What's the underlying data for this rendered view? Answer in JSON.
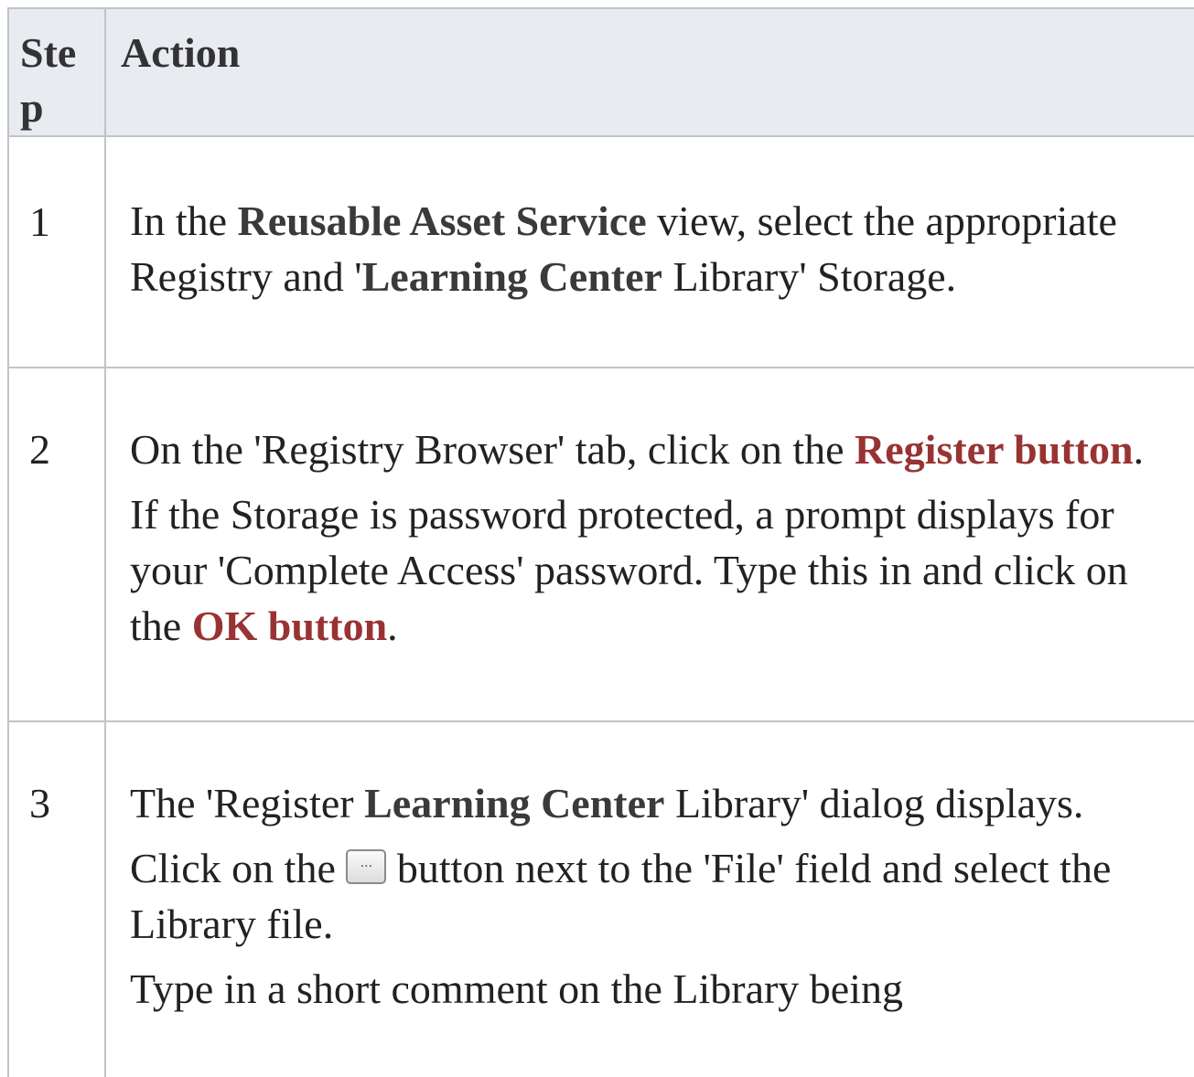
{
  "header": {
    "step": "Ste p",
    "action": "Action"
  },
  "rows": [
    {
      "step": "1",
      "p1": {
        "a": "In the ",
        "b": "Reusable Asset Service",
        "c": " view, select the appropriate Registry and '",
        "d": "Learning Center",
        "e": " Library' Storage."
      }
    },
    {
      "step": "2",
      "p1": {
        "a": "On the 'Registry Browser' tab, click on the ",
        "b": "Register button",
        "c": "."
      },
      "p2": {
        "a": "If the Storage is password protected, a prompt displays for your 'Complete Access' password. Type this in and click on the ",
        "b": "OK button",
        "c": "."
      }
    },
    {
      "step": "3",
      "p1": {
        "a": "The 'Register ",
        "b": "Learning Center",
        "c": " Library' dialog displays."
      },
      "p2": {
        "a": "Click on the ",
        "icon": "ellipsis-button-icon",
        "icon_glyph": "...",
        "c": " button next to the 'File' field and select the Library file."
      },
      "p3": {
        "a": "Type in a short comment on the Library being"
      }
    }
  ],
  "colors": {
    "header_bg": "#e8ebf0",
    "border": "#c0c4ca",
    "button_text": "#993333"
  }
}
